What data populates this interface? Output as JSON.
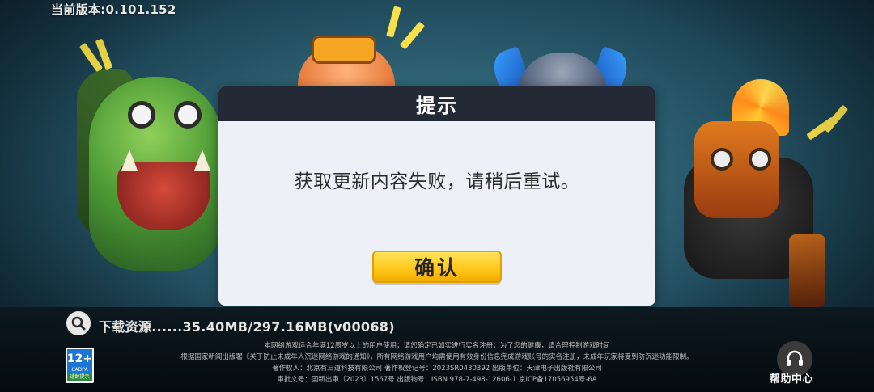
{
  "version_label": "当前版本:0.101.152",
  "dialog": {
    "title": "提示",
    "message": "获取更新内容失败，请稍后重试。",
    "confirm_label": "确认"
  },
  "download": {
    "status_text": "下载资源......35.40MB/297.16MB(v00068)"
  },
  "age_rating": {
    "label": "12+",
    "org": "CADPA",
    "tip": "适龄提示"
  },
  "notices": [
    "本网络游戏适合年满12周岁以上的用户使用；请您确定已如实进行实名注册；为了您的健康，请合理控制游戏时间",
    "根据国家新闻出版署《关于防止未成年人沉迷网络游戏的通知》，所有网络游戏用户均需使用有效身份信息完成游戏账号的实名注册，未成年玩家将受到防沉迷功能限制。",
    "著作权人：北京有三道科技有限公司 著作权登记号：2023SR0430392 出版单位：天津电子出版社有限公司",
    "审批文号：国新出审〔2023〕1567号 出版物号：ISBN 978-7-498-12606-1 京ICP备17056954号-6A"
  ],
  "help": {
    "label": "帮助中心"
  },
  "colors": {
    "dialog_header": "#232a36",
    "dialog_body": "#edf1f7",
    "confirm_button": "#ffc61a",
    "age_badge": "#1976d2"
  },
  "icons": [
    "search-icon",
    "headset-help-icon"
  ]
}
